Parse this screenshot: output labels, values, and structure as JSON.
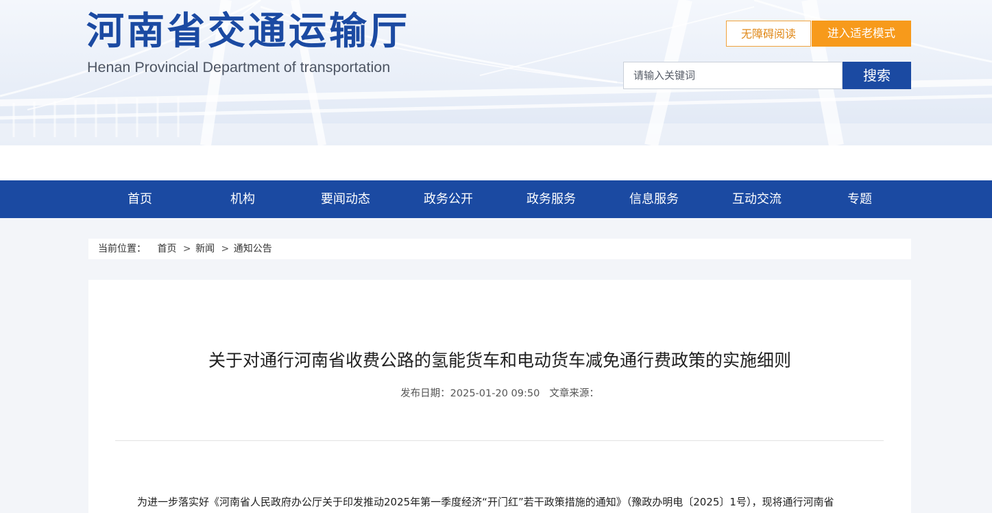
{
  "header": {
    "logo_cn": "河南省交通运输厅",
    "logo_en": "Henan Provincial Department of transportation",
    "accessibility_label": "无障碍阅读",
    "elder_mode_label": "进入适老模式",
    "search_placeholder": "请输入关键词",
    "search_label": "搜索"
  },
  "nav": {
    "items": [
      "首页",
      "机构",
      "要闻动态",
      "政务公开",
      "政务服务",
      "信息服务",
      "互动交流",
      "专题"
    ]
  },
  "breadcrumb": {
    "label": "当前位置：",
    "items": [
      "首页",
      "新闻",
      "通知公告"
    ],
    "separator": ">"
  },
  "article": {
    "title": "关于对通行河南省收费公路的氢能货车和电动货车减免通行费政策的实施细则",
    "date_label": "发布日期：",
    "date": "2025-01-20 09:50",
    "source_label": "文章来源：",
    "body_first_line": "为进一步落实好《河南省人民政府办公厅关于印发推动2025年第一季度经济“开门红”若干政策措施的通知》（豫政办明电〔2025〕1号），现将通行河南省"
  },
  "colors": {
    "brand_blue": "#1b4aa2",
    "accent_orange": "#f79a1b",
    "page_bg": "#f3f5f9"
  }
}
